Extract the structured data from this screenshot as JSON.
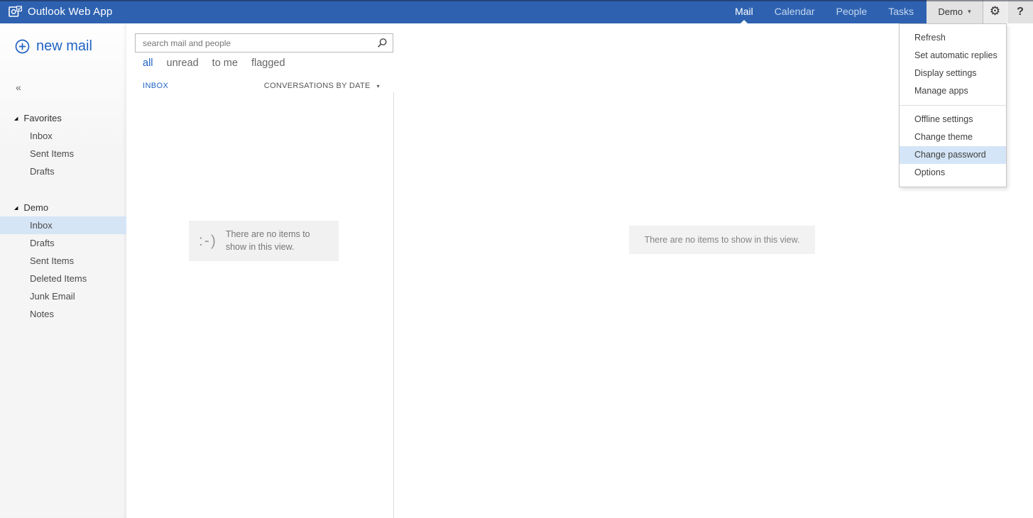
{
  "topbar": {
    "app_title": "Outlook Web App",
    "nav": [
      {
        "label": "Mail",
        "active": true
      },
      {
        "label": "Calendar",
        "active": false
      },
      {
        "label": "People",
        "active": false
      },
      {
        "label": "Tasks",
        "active": false
      }
    ],
    "user_label": "Demo",
    "help_label": "?"
  },
  "settings_menu": {
    "groups": [
      {
        "items": [
          {
            "label": "Refresh"
          },
          {
            "label": "Set automatic replies"
          },
          {
            "label": "Display settings"
          },
          {
            "label": "Manage apps"
          }
        ]
      },
      {
        "items": [
          {
            "label": "Offline settings"
          },
          {
            "label": "Change theme"
          },
          {
            "label": "Change password",
            "highlighted": true
          },
          {
            "label": "Options"
          }
        ]
      }
    ]
  },
  "sidebar": {
    "new_mail_label": "new mail",
    "collapse_glyph": "«",
    "sections": [
      {
        "label": "Favorites",
        "expanded": true,
        "items": [
          {
            "label": "Inbox",
            "selected": false
          },
          {
            "label": "Sent Items",
            "selected": false
          },
          {
            "label": "Drafts",
            "selected": false
          }
        ]
      },
      {
        "label": "Demo",
        "expanded": true,
        "items": [
          {
            "label": "Inbox",
            "selected": true
          },
          {
            "label": "Drafts",
            "selected": false
          },
          {
            "label": "Sent Items",
            "selected": false
          },
          {
            "label": "Deleted Items",
            "selected": false
          },
          {
            "label": "Junk Email",
            "selected": false
          },
          {
            "label": "Notes",
            "selected": false
          }
        ]
      }
    ]
  },
  "list_pane": {
    "search_placeholder": "search mail and people",
    "filters": [
      {
        "label": "all",
        "active": true
      },
      {
        "label": "unread",
        "active": false
      },
      {
        "label": "to me",
        "active": false
      },
      {
        "label": "flagged",
        "active": false
      }
    ],
    "folder_label": "INBOX",
    "sort_label": "CONVERSATIONS BY DATE",
    "empty_state": {
      "icon_text": ":-)",
      "message": "There are no items to show in this view."
    }
  },
  "reading_pane": {
    "empty_message": "There are no items to show in this view."
  },
  "colors": {
    "topbar_blue": "#2E62B1",
    "accent_blue": "#2063C5",
    "selection_blue": "#D5E5F6",
    "menu_highlight": "#D4E5F7",
    "empty_box_gray": "#F1F1F1"
  }
}
